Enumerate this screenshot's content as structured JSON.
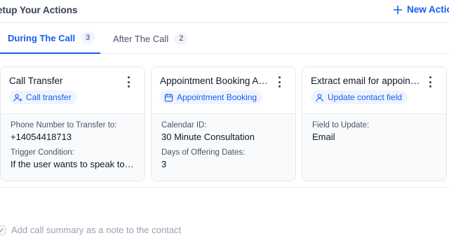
{
  "header": {
    "title": "etup Your Actions",
    "new_action_label": "New Action"
  },
  "tabs": [
    {
      "label": "During The Call",
      "count": "3",
      "active": true
    },
    {
      "label": "After The Call",
      "count": "2",
      "active": false
    }
  ],
  "cards": [
    {
      "title": "Call Transfer",
      "chip": "Call transfer",
      "chip_icon": "user-plus-icon",
      "fields": [
        {
          "label": "Phone Number to Transfer to:",
          "value": "+14054418713"
        },
        {
          "label": "Trigger Condition:",
          "value": "If the user wants to speak to a human"
        }
      ]
    },
    {
      "title": "Appointment Booking Appointment",
      "chip": "Appointment Booking",
      "chip_icon": "calendar-icon",
      "fields": [
        {
          "label": "Calendar ID:",
          "value": "30 Minute Consultation"
        },
        {
          "label": "Days of Offering Dates:",
          "value": "3"
        }
      ]
    },
    {
      "title": "Extract email for appointment",
      "chip": "Update contact field",
      "chip_icon": "user-icon",
      "fields": [
        {
          "label": "Field to Update:",
          "value": "Email"
        }
      ]
    }
  ],
  "summary": {
    "label": "Add call summary as a note to the contact",
    "checked": true
  },
  "colors": {
    "accent": "#155eef",
    "muted": "#98a2b3",
    "border": "#eaecf0"
  }
}
